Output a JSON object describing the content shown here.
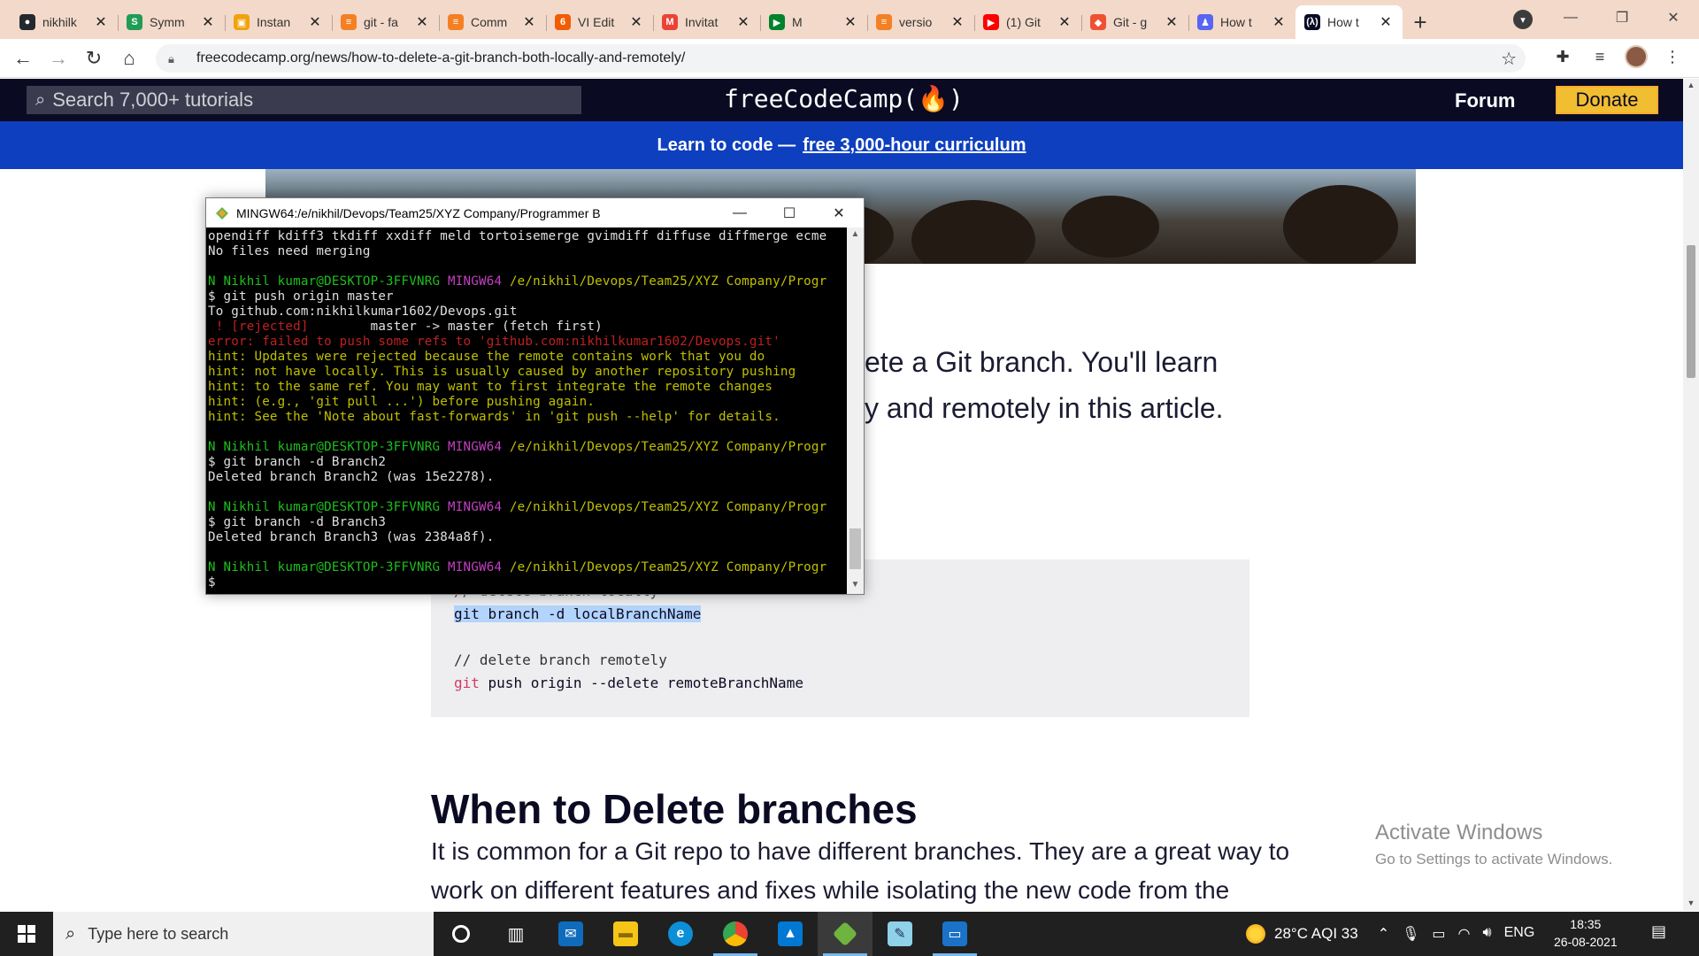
{
  "browser": {
    "tabs": [
      {
        "title": "nikhilk",
        "favicon": "github-icon",
        "color": "#24292e",
        "glyph": "●"
      },
      {
        "title": "Symm",
        "favicon": "symmetry-icon",
        "color": "#1f9d55",
        "glyph": "S"
      },
      {
        "title": "Instan",
        "favicon": "aws-icon",
        "color": "#f0a30a",
        "glyph": "▣"
      },
      {
        "title": "git - fa",
        "favicon": "stackoverflow-icon",
        "color": "#f48024",
        "glyph": "≡"
      },
      {
        "title": "Comm",
        "favicon": "stackoverflow-icon",
        "color": "#f48024",
        "glyph": "≡"
      },
      {
        "title": "VI Edit",
        "favicon": "orange-circle-icon",
        "color": "#f25c05",
        "glyph": "6"
      },
      {
        "title": "Invitat",
        "favicon": "gmail-icon",
        "color": "#ea4335",
        "glyph": "M"
      },
      {
        "title": "M",
        "favicon": "meet-icon",
        "color": "#00832d",
        "glyph": "▶"
      },
      {
        "title": "versio",
        "favicon": "stackoverflow-icon",
        "color": "#f48024",
        "glyph": "≡"
      },
      {
        "title": "(1) Git",
        "favicon": "youtube-icon",
        "color": "#ff0000",
        "glyph": "▶"
      },
      {
        "title": "Git - g",
        "favicon": "git-icon",
        "color": "#f05032",
        "glyph": "◆"
      },
      {
        "title": "How t",
        "favicon": "person-icon",
        "color": "#5865f2",
        "glyph": "♟"
      },
      {
        "title": "How t",
        "favicon": "freecodecamp-icon",
        "color": "#0a0a23",
        "glyph": "(λ)",
        "active": true
      }
    ],
    "url": "freecodecamp.org/news/how-to-delete-a-git-branch-both-locally-and-remotely/"
  },
  "fcc": {
    "search_placeholder": "Search 7,000+ tutorials",
    "logo": "freeCodeCamp(🔥)",
    "forum": "Forum",
    "donate": "Donate",
    "banner_text": "Learn to code —",
    "banner_link": "free 3,000-hour curriculum"
  },
  "article": {
    "intro_line1": "ete a Git branch. You'll learn",
    "intro_line2": "y and remotely in this article.",
    "code": {
      "line1": "// delete branch locally",
      "line2_kw": "git",
      "line2_rest": " branch -d localBranchName",
      "line3": "// delete branch remotely",
      "line4_kw": "git",
      "line4_rest": " push origin --delete remoteBranchName"
    },
    "heading": "When to Delete branches",
    "para_line1": "It is common for a Git repo to have different branches. They are a great way to",
    "para_line2": "work on different features and fixes while isolating the new code from the"
  },
  "watermark": {
    "title": "Activate Windows",
    "subtitle": "Go to Settings to activate Windows."
  },
  "terminal": {
    "title": "MINGW64:/e/nikhil/Devops/Team25/XYZ Company/Programmer B",
    "lines": [
      {
        "segs": [
          {
            "t": "opendiff kdiff3 tkdiff xxdiff meld tortoisemerge gvimdiff diffuse diffmerge ecme",
            "c": "c-white"
          }
        ]
      },
      {
        "segs": [
          {
            "t": "No files need merging",
            "c": "c-white"
          }
        ]
      },
      {
        "segs": [
          {
            "t": "",
            "c": "c-white"
          }
        ]
      },
      {
        "segs": [
          {
            "t": "N Nikhil kumar@DESKTOP-3FFVNRG ",
            "c": "c-green"
          },
          {
            "t": "MINGW64 ",
            "c": "c-mag"
          },
          {
            "t": "/e/nikhil/Devops/Team25/XYZ Company/Progr",
            "c": "c-yel"
          }
        ]
      },
      {
        "segs": [
          {
            "t": "$ git push origin master",
            "c": "c-white"
          }
        ]
      },
      {
        "segs": [
          {
            "t": "To github.com:nikhilkumar1602/Devops.git",
            "c": "c-white"
          }
        ]
      },
      {
        "segs": [
          {
            "t": " ! [rejected]        ",
            "c": "c-red"
          },
          {
            "t": "master -> master (fetch first)",
            "c": "c-white"
          }
        ]
      },
      {
        "segs": [
          {
            "t": "error: failed to push some refs to 'github.com:nikhilkumar1602/Devops.git'",
            "c": "c-red"
          }
        ]
      },
      {
        "segs": [
          {
            "t": "hint: Updates were rejected because the remote contains work that you do",
            "c": "c-yel"
          }
        ]
      },
      {
        "segs": [
          {
            "t": "hint: not have locally. This is usually caused by another repository pushing",
            "c": "c-yel"
          }
        ]
      },
      {
        "segs": [
          {
            "t": "hint: to the same ref. You may want to first integrate the remote changes",
            "c": "c-yel"
          }
        ]
      },
      {
        "segs": [
          {
            "t": "hint: (e.g., 'git pull ...') before pushing again.",
            "c": "c-yel"
          }
        ]
      },
      {
        "segs": [
          {
            "t": "hint: See the 'Note about fast-forwards' in 'git push --help' for details.",
            "c": "c-yel"
          }
        ]
      },
      {
        "segs": [
          {
            "t": "",
            "c": "c-white"
          }
        ]
      },
      {
        "segs": [
          {
            "t": "N Nikhil kumar@DESKTOP-3FFVNRG ",
            "c": "c-green"
          },
          {
            "t": "MINGW64 ",
            "c": "c-mag"
          },
          {
            "t": "/e/nikhil/Devops/Team25/XYZ Company/Progr",
            "c": "c-yel"
          }
        ]
      },
      {
        "segs": [
          {
            "t": "$ git branch -d Branch2",
            "c": "c-white"
          }
        ]
      },
      {
        "segs": [
          {
            "t": "Deleted branch Branch2 (was 15e2278).",
            "c": "c-white"
          }
        ]
      },
      {
        "segs": [
          {
            "t": "",
            "c": "c-white"
          }
        ]
      },
      {
        "segs": [
          {
            "t": "N Nikhil kumar@DESKTOP-3FFVNRG ",
            "c": "c-green"
          },
          {
            "t": "MINGW64 ",
            "c": "c-mag"
          },
          {
            "t": "/e/nikhil/Devops/Team25/XYZ Company/Progr",
            "c": "c-yel"
          }
        ]
      },
      {
        "segs": [
          {
            "t": "$ git branch -d Branch3",
            "c": "c-white"
          }
        ]
      },
      {
        "segs": [
          {
            "t": "Deleted branch Branch3 (was 2384a8f).",
            "c": "c-white"
          }
        ]
      },
      {
        "segs": [
          {
            "t": "",
            "c": "c-white"
          }
        ]
      },
      {
        "segs": [
          {
            "t": "N Nikhil kumar@DESKTOP-3FFVNRG ",
            "c": "c-green"
          },
          {
            "t": "MINGW64 ",
            "c": "c-mag"
          },
          {
            "t": "/e/nikhil/Devops/Team25/XYZ Company/Progr",
            "c": "c-yel"
          }
        ]
      },
      {
        "segs": [
          {
            "t": "$",
            "c": "c-white"
          }
        ]
      }
    ]
  },
  "taskbar": {
    "search_placeholder": "Type here to search",
    "weather": "28°C  AQI 33",
    "lang": "ENG",
    "time": "18:35",
    "date": "26-08-2021"
  }
}
